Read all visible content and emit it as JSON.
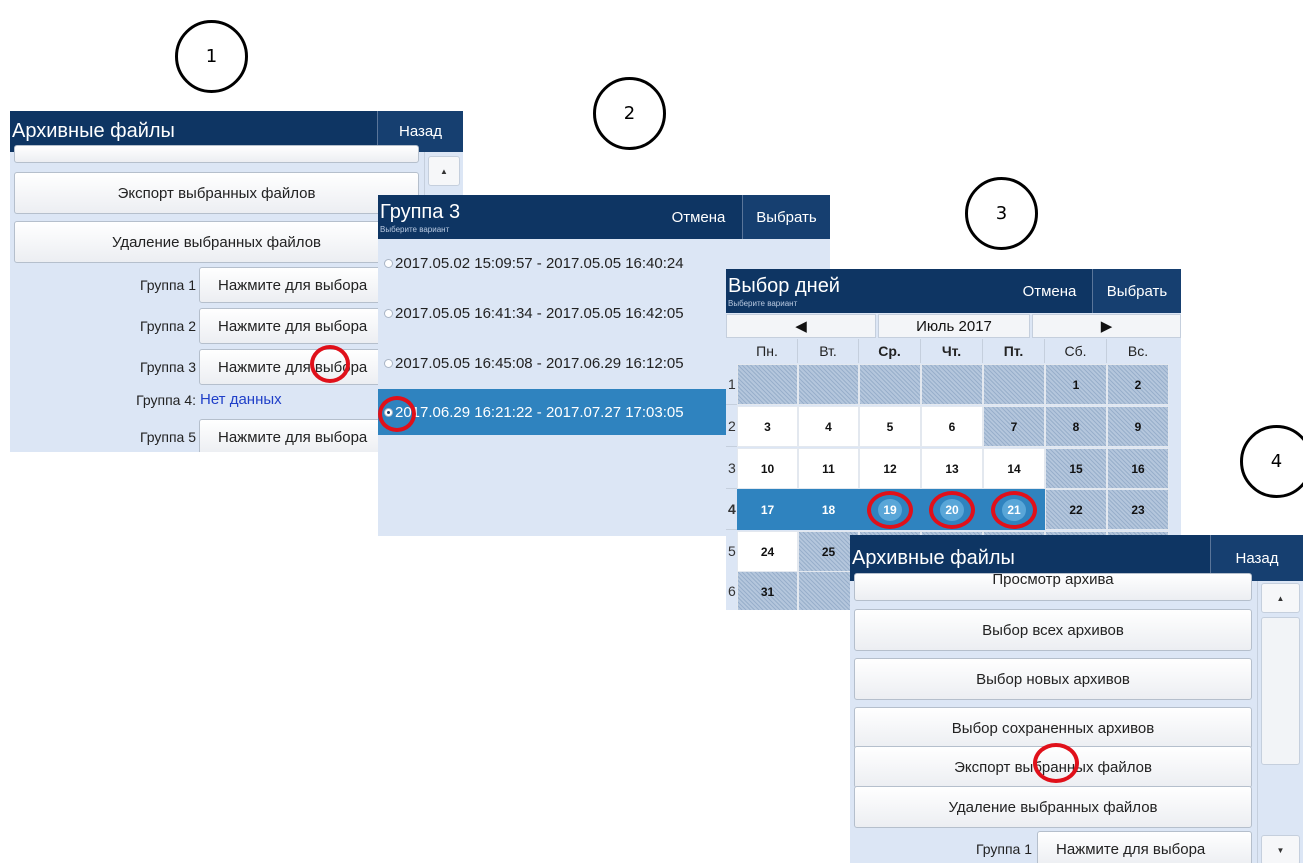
{
  "steps": [
    "1",
    "2",
    "3",
    "4"
  ],
  "panel1": {
    "title": "Архивные файлы",
    "back_label": "Назад",
    "export_label": "Экспорт выбранных файлов",
    "delete_label": "Удаление выбранных файлов",
    "groups": [
      {
        "label": "Группа 1",
        "value": "Нажмите для выбора"
      },
      {
        "label": "Группа 2",
        "value": "Нажмите для выбора"
      },
      {
        "label": "Группа 3",
        "value": "Нажмите для выбора"
      },
      {
        "label": "Группа 4:",
        "value": "Нет данных"
      },
      {
        "label": "Группа 5",
        "value": "Нажмите для выбора"
      }
    ],
    "scroll_up_icon": "triangle-up-icon"
  },
  "panel2": {
    "title": "Группа 3",
    "subtitle": "Выберите вариант",
    "cancel_label": "Отмена",
    "select_label": "Выбрать",
    "options": [
      {
        "text": "2017.05.02 15:09:57 - 2017.05.05 16:40:24",
        "selected": false
      },
      {
        "text": "2017.05.05 16:41:34 - 2017.05.05 16:42:05",
        "selected": false
      },
      {
        "text": "2017.05.05 16:45:08 - 2017.06.29 16:12:05",
        "selected": false
      },
      {
        "text": "2017.06.29 16:21:22 - 2017.07.27 17:03:05",
        "selected": true
      }
    ]
  },
  "panel3": {
    "title": "Выбор дней",
    "subtitle": "Выберите вариант",
    "cancel_label": "Отмена",
    "select_label": "Выбрать",
    "prev_icon": "triangle-left-icon",
    "next_icon": "triangle-right-icon",
    "month_label": "Июль 2017",
    "weekdays": [
      "Пн.",
      "Вт.",
      "Ср.",
      "Чт.",
      "Пт.",
      "Сб.",
      "Вс."
    ],
    "weeks": [
      {
        "num": "1",
        "days": [
          "",
          "",
          "",
          "",
          "",
          "1",
          "2"
        ]
      },
      {
        "num": "2",
        "days": [
          "3",
          "4",
          "5",
          "6",
          "7",
          "8",
          "9"
        ]
      },
      {
        "num": "3",
        "days": [
          "10",
          "11",
          "12",
          "13",
          "14",
          "15",
          "16"
        ]
      },
      {
        "num": "4",
        "days": [
          "17",
          "18",
          "19",
          "20",
          "21",
          "22",
          "23"
        ]
      },
      {
        "num": "5",
        "days": [
          "24",
          "25",
          "",
          "",
          "",
          "",
          ""
        ]
      },
      {
        "num": "6",
        "days": [
          "31",
          "",
          "",
          "",
          "",
          "",
          ""
        ]
      }
    ]
  },
  "panel4": {
    "title": "Архивные файлы",
    "back_label": "Назад",
    "view_label": "Просмотр архива",
    "buttons": [
      "Выбор всех архивов",
      "Выбор новых архивов",
      "Выбор сохраненных архивов",
      "Экспорт выбранных файлов",
      "Удаление выбранных файлов"
    ],
    "group1_label": "Группа 1",
    "group1_value": "Нажмите для выбора",
    "scroll_up_icon": "triangle-up-icon",
    "scroll_down_icon": "triangle-down-icon"
  },
  "colors": {
    "titlebar": "#0e3563",
    "panel_bg": "#dce6f5",
    "selected_blue": "#2f83bf",
    "link_blue": "#1f3fc8",
    "annotation_red": "#e0101a"
  }
}
